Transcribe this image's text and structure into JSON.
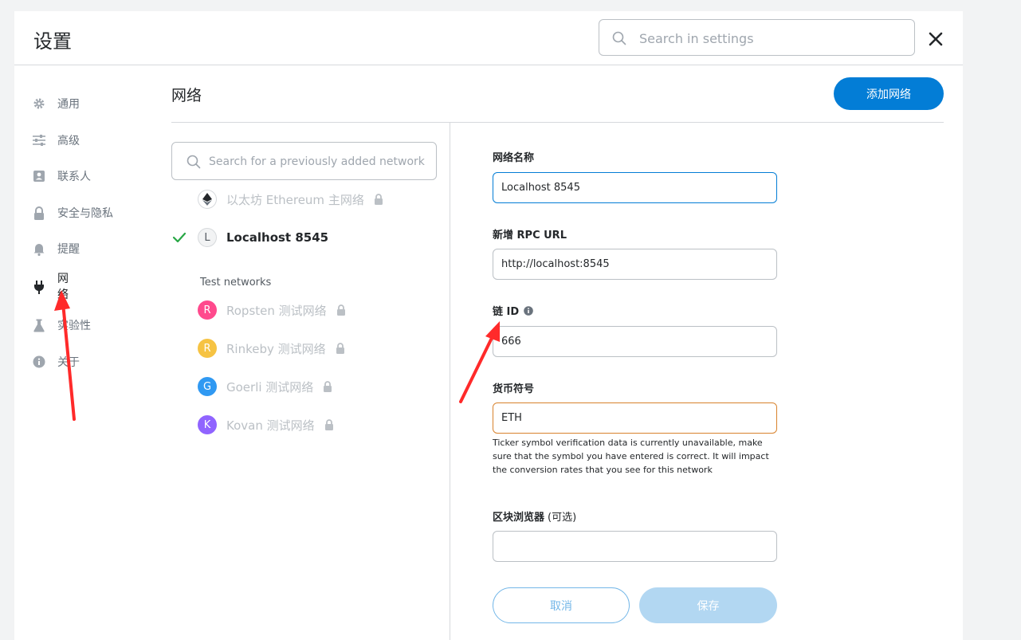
{
  "header": {
    "title": "设置",
    "search_placeholder": "Search in settings"
  },
  "sidebar": {
    "items": [
      {
        "label": "通用",
        "icon": "gear-icon"
      },
      {
        "label": "高级",
        "icon": "sliders-icon"
      },
      {
        "label": "联系人",
        "icon": "contact-book-icon"
      },
      {
        "label": "安全与隐私",
        "icon": "lock-icon"
      },
      {
        "label": "提醒",
        "icon": "bell-icon"
      },
      {
        "label": "网络",
        "icon": "plug-icon",
        "active": true
      },
      {
        "label": "实验性",
        "icon": "flask-icon"
      },
      {
        "label": "关于",
        "icon": "info-icon"
      }
    ]
  },
  "content": {
    "title": "网络",
    "add_button": "添加网络"
  },
  "networks": {
    "search_placeholder": "Search for a previously added network",
    "main": [
      {
        "name": "以太坊 Ethereum 主网络",
        "avatar": "",
        "locked": true,
        "selected": false
      },
      {
        "name": "Localhost 8545",
        "avatar": "L",
        "locked": false,
        "selected": true
      }
    ],
    "test_label": "Test networks",
    "test": [
      {
        "name": "Ropsten 测试网络",
        "avatar": "R",
        "color": "#ff4a8d",
        "locked": true
      },
      {
        "name": "Rinkeby 测试网络",
        "avatar": "R",
        "color": "#f6c343",
        "locked": true
      },
      {
        "name": "Goerli 测试网络",
        "avatar": "G",
        "color": "#3099f2",
        "locked": true
      },
      {
        "name": "Kovan 测试网络",
        "avatar": "K",
        "color": "#9064ff",
        "locked": true
      }
    ]
  },
  "form": {
    "network_name_label": "网络名称",
    "network_name_value": "Localhost 8545",
    "rpc_label": "新增 RPC URL",
    "rpc_value": "http://localhost:8545",
    "chain_id_label": "链 ID",
    "chain_id_value": "666",
    "symbol_label": "货币符号",
    "symbol_value": "ETH",
    "symbol_warning": "Ticker symbol verification data is currently unavailable, make sure that the symbol you have entered is correct. It will impact the conversion rates that you see for this network",
    "explorer_label": "区块浏览器",
    "explorer_optional": "(可选)",
    "explorer_value": "",
    "cancel": "取消",
    "save": "保存"
  },
  "colors": {
    "accent": "#037dd6",
    "warning": "#d8822c",
    "annotation_arrow": "#ff2a2a",
    "success": "#28a745"
  }
}
